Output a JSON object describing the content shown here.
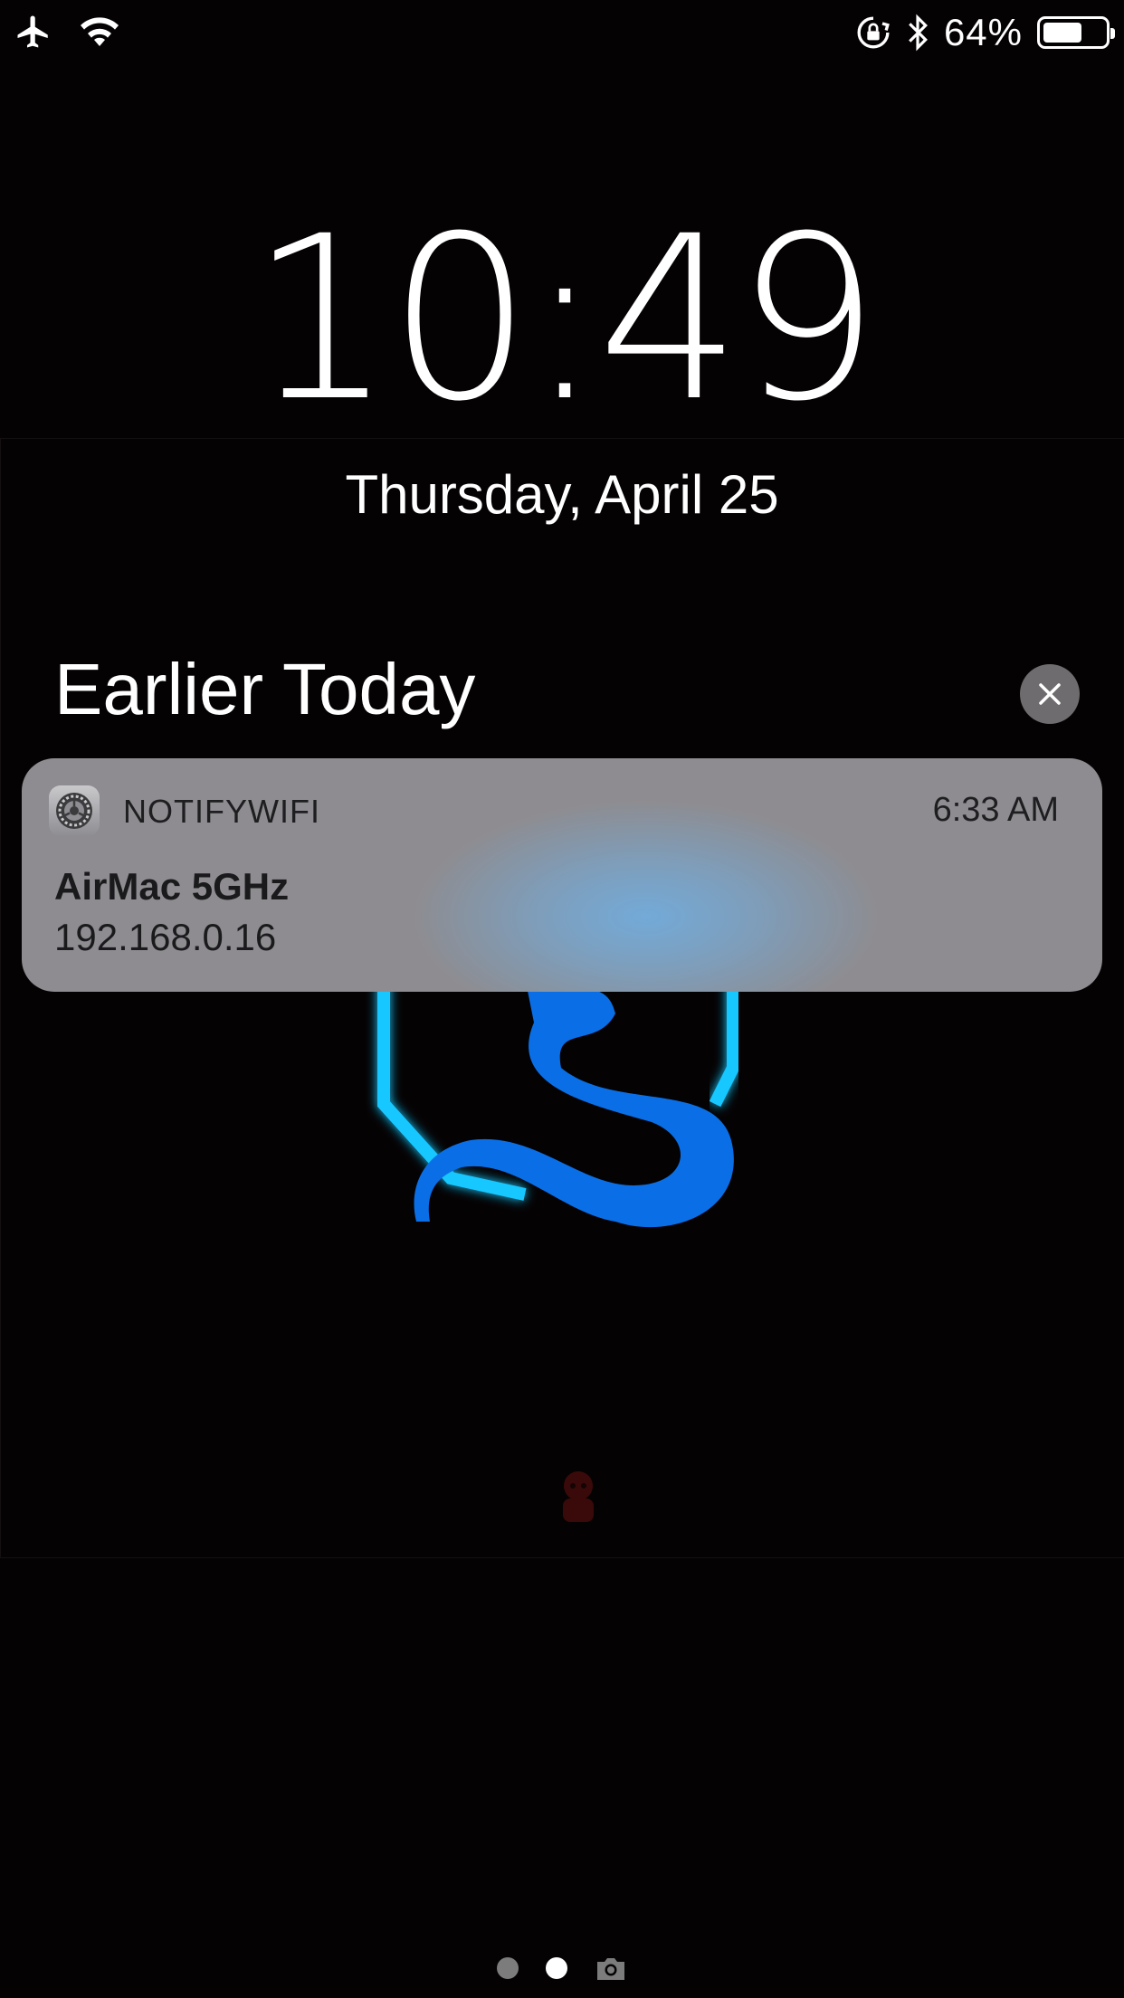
{
  "status_bar": {
    "icons": [
      "airplane-icon",
      "wifi-icon",
      "orientation-lock-icon",
      "bluetooth-icon",
      "battery-icon"
    ],
    "battery_percent": "64%",
    "battery_level": 0.64
  },
  "lock_screen": {
    "time": "10:49",
    "date": "Thursday, April 25"
  },
  "notifications": {
    "section_title": "Earlier Today",
    "clear_icon": "close-icon",
    "items": [
      {
        "app_name": "NOTIFYWIFI",
        "app_icon": "settings-gear-icon",
        "time": "6:33 AM",
        "title": "AirMac 5GHz",
        "body": "192.168.0.16"
      }
    ]
  },
  "page_indicator": {
    "pages": 2,
    "active_page": 2,
    "camera_icon": "camera-icon"
  },
  "colors": {
    "background": "#050203",
    "notification_bg": "#8e8c90",
    "emblem_blue": "#0a6fe6",
    "emblem_glow": "#19c8ff"
  }
}
